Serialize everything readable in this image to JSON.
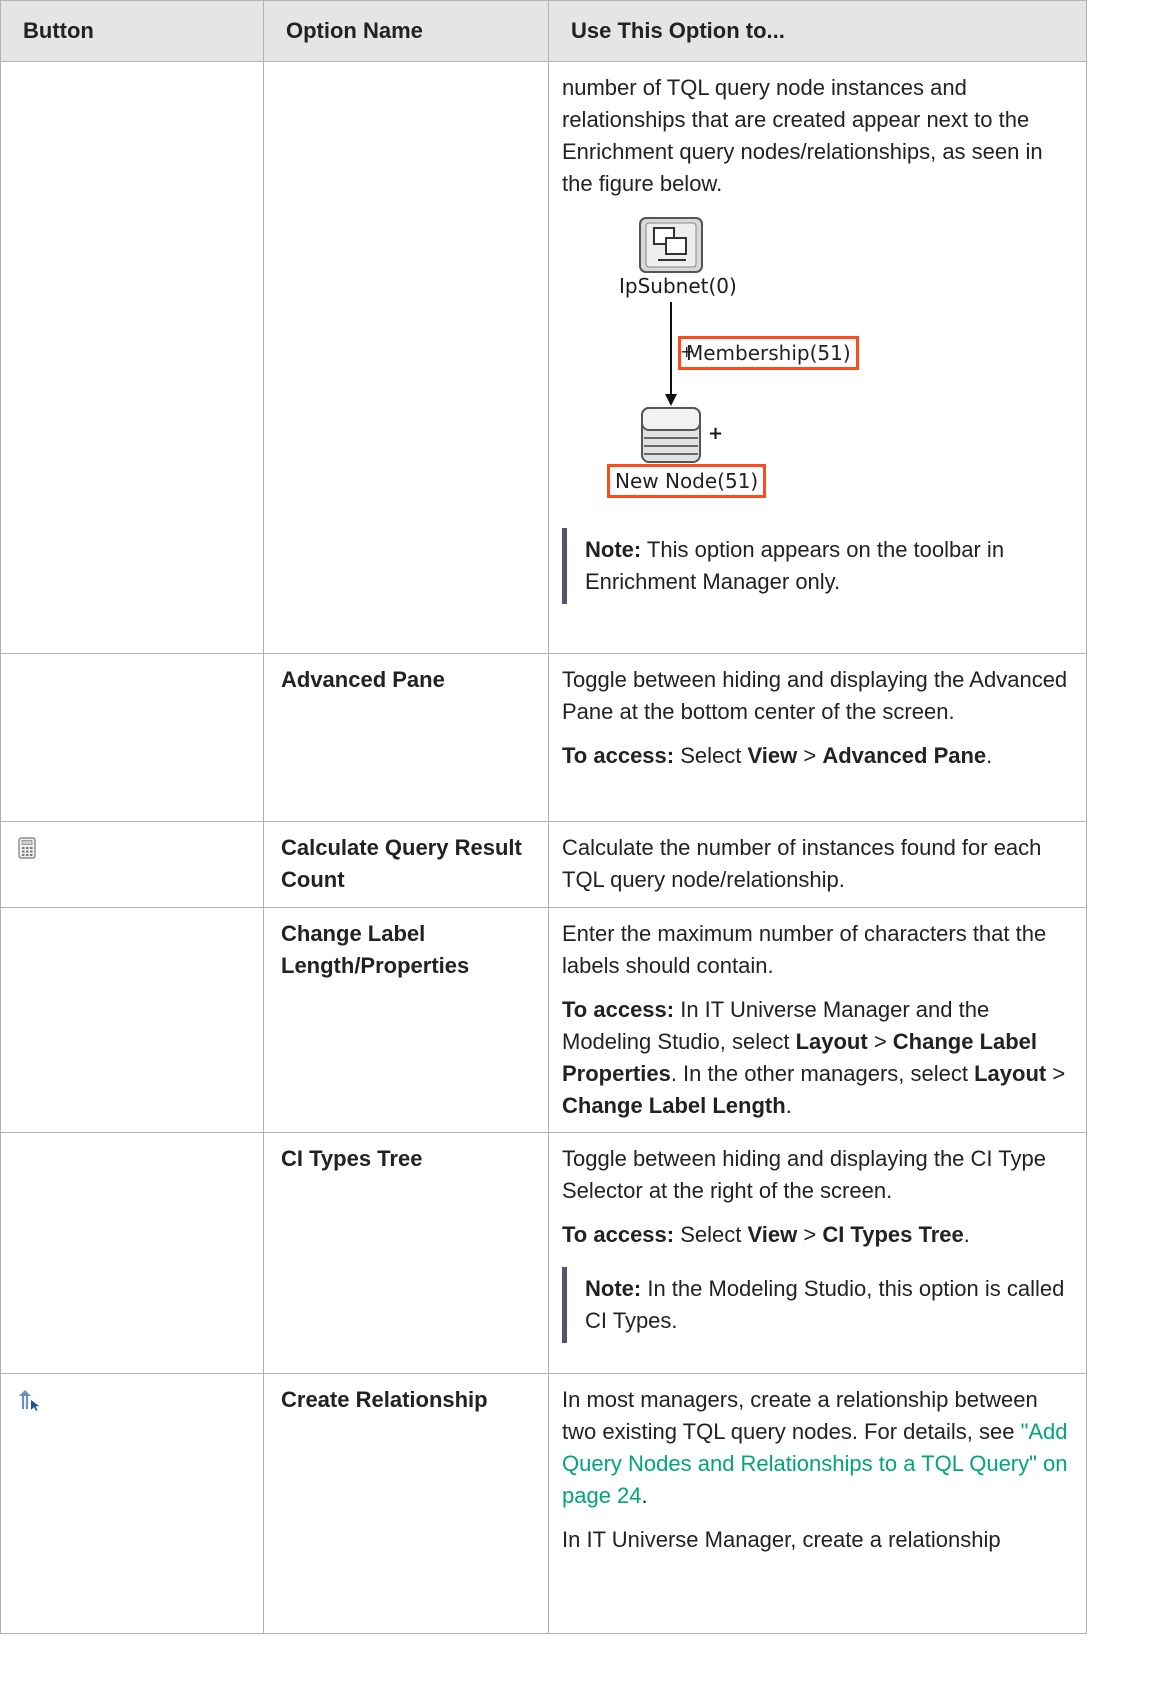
{
  "header": {
    "col1": "Button",
    "col2": "Option Name",
    "col3": "Use This Option to..."
  },
  "row_intro": {
    "text": "number of TQL query node instances and relationships that are created appear next to the Enrichment query nodes/relationships, as seen in the figure below.",
    "figure": {
      "top_node_label": "IpSubnet(0)",
      "relationship_label": "Membership(51)",
      "bottom_node_label": "New Node(51)",
      "plus_sign": "+",
      "plus_small": "+"
    },
    "note_label": "Note:",
    "note_text": " This option appears on the toolbar in Enrichment Manager only."
  },
  "row_advanced": {
    "name": "Advanced Pane",
    "desc": "Toggle between hiding and displaying the Advanced Pane at the bottom center of the screen.",
    "access_label": "To access:",
    "access_pre": " Select ",
    "access_view": "View",
    "access_sep": " > ",
    "access_item": "Advanced Pane",
    "access_end": "."
  },
  "row_calc": {
    "icon": "calculator-icon",
    "name": "Calculate Query Result Count",
    "desc": "Calculate the number of instances found for each TQL query node/relationship."
  },
  "row_label": {
    "name": "Change Label Length/Properties",
    "desc": "Enter the maximum number of characters that the labels should contain.",
    "access_label": "To access:",
    "t1": " In IT Universe Manager and the Modeling Studio, select ",
    "b1": "Layout",
    "t2": " > ",
    "b2": "Change Label Properties",
    "t3": ". In the other managers, select ",
    "b3": "Layout",
    "t4": " > ",
    "b4": "Change Label Length",
    "t5": "."
  },
  "row_citypes": {
    "name": "CI Types Tree",
    "desc": "Toggle between hiding and displaying the CI Type Selector at the right of the screen.",
    "access_label": "To access:",
    "access_pre": " Select ",
    "access_view": "View",
    "access_sep": " > ",
    "access_item": "CI Types Tree",
    "access_end": ".",
    "note_label": "Note:",
    "note_text": " In the Modeling Studio, this option is called CI Types."
  },
  "row_createrel": {
    "icon": "create-relationship-icon",
    "name": "Create Relationship",
    "desc_pre": "In most managers, create a relationship between two existing TQL query nodes. For details, see ",
    "link": "\"Add Query Nodes and Relationships to a TQL Query\" on page 24",
    "desc_end": ".",
    "desc2": "In IT Universe Manager, create a relationship"
  }
}
